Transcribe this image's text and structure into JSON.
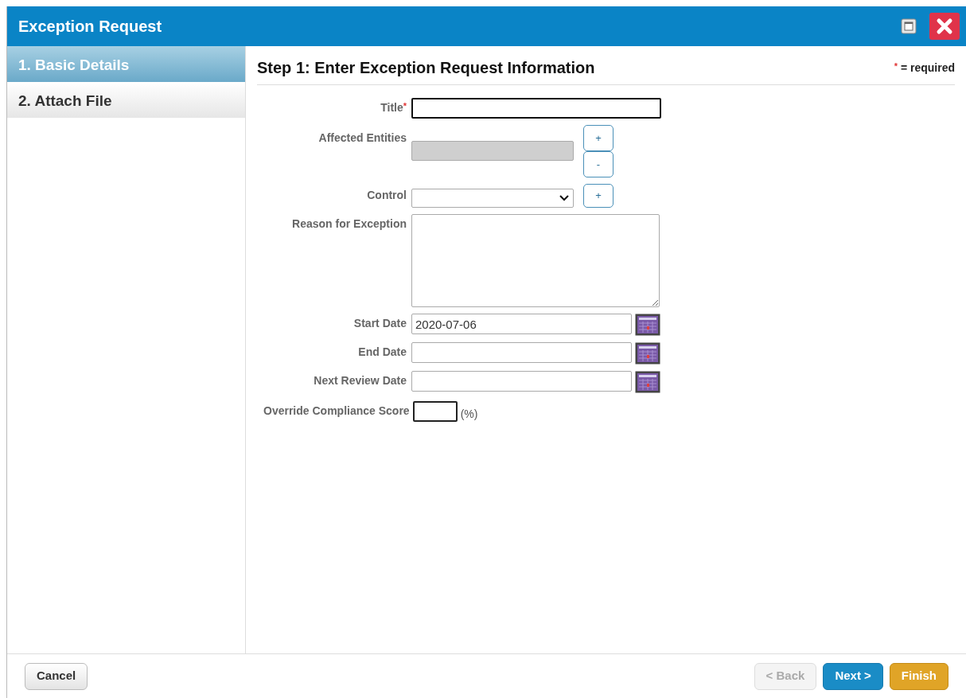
{
  "window": {
    "title": "Exception Request"
  },
  "steps": [
    {
      "label": "1. Basic Details",
      "selected": true
    },
    {
      "label": "2. Attach File",
      "selected": false
    }
  ],
  "form": {
    "heading": "Step 1: Enter Exception Request Information",
    "required_mark": "*",
    "required_note": "= required",
    "fields": [
      {
        "kind": "text",
        "label": "Title",
        "required": true,
        "focused": true
      },
      {
        "kind": "entities",
        "label": "Affected Entities",
        "required": false,
        "add": "+",
        "remove": "-"
      },
      {
        "kind": "select",
        "label": "Control",
        "required": false,
        "add": "+"
      },
      {
        "kind": "textarea",
        "label": "Reason for Exception",
        "required": false
      },
      {
        "kind": "date",
        "label": "Start Date",
        "required": false,
        "value": "2020-07-06"
      },
      {
        "kind": "date",
        "label": "End Date",
        "required": false
      },
      {
        "kind": "date",
        "label": "Next Review Date",
        "required": false
      },
      {
        "kind": "score",
        "label": "Override Compliance Score",
        "required": false,
        "suffix": "(%)"
      }
    ]
  },
  "footer": {
    "buttons": [
      {
        "label": "Cancel",
        "kind": "cancel",
        "disabled": false
      },
      {
        "label": "< Back",
        "kind": "back",
        "disabled": true
      },
      {
        "label": "Next >",
        "kind": "next",
        "disabled": false
      },
      {
        "label": "Finish",
        "kind": "finish",
        "disabled": false
      }
    ]
  }
}
